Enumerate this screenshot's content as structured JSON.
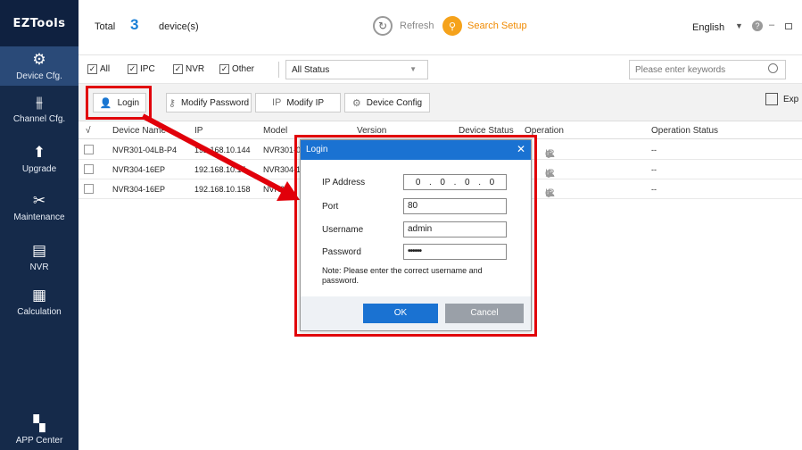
{
  "app": {
    "logo": "EZTools"
  },
  "sidebar": {
    "items": [
      {
        "label": "Device Cfg.",
        "icon": "gear-icon",
        "glyph": "⚙",
        "active": true
      },
      {
        "label": "Channel Cfg.",
        "icon": "sliders-icon",
        "glyph": "⫵"
      },
      {
        "label": "Upgrade",
        "icon": "upgrade-icon",
        "glyph": "⬆"
      },
      {
        "label": "Maintenance",
        "icon": "tools-icon",
        "glyph": "✂"
      },
      {
        "label": "NVR",
        "icon": "nvr-icon",
        "glyph": "▤"
      },
      {
        "label": "Calculation",
        "icon": "calculator-icon",
        "glyph": "▦"
      },
      {
        "label": "APP Center",
        "icon": "app-grid-icon",
        "glyph": "▚"
      }
    ]
  },
  "header": {
    "total_label": "Total",
    "total_count": "3",
    "devices_label": "device(s)",
    "refresh_label": "Refresh",
    "search_setup_label": "Search Setup",
    "language": "English"
  },
  "filters": {
    "all_label": "All",
    "ipc_label": "IPC",
    "nvr_label": "NVR",
    "other_label": "Other",
    "status_value": "All Status",
    "search_placeholder": "Please enter keywords"
  },
  "toolbar": {
    "login_label": "Login",
    "modify_password_label": "Modify Password",
    "modify_ip_label": "Modify IP",
    "device_config_label": "Device Config",
    "export_label": "Exp"
  },
  "table": {
    "columns": {
      "check": "√",
      "device_name": "Device Name",
      "ip": "IP",
      "model": "Model",
      "version": "Version",
      "device_status": "Device Status",
      "operation": "Operation",
      "operation_status": "Operation Status"
    },
    "rows": [
      {
        "name": "NVR301-04LB-P4",
        "ip": "192.168.10.144",
        "model": "NVR301-0",
        "op_status": "--"
      },
      {
        "name": "NVR304-16EP",
        "ip": "192.168.10.15",
        "model": "NVR304-1",
        "op_status": "--"
      },
      {
        "name": "NVR304-16EP",
        "ip": "192.168.10.158",
        "model": "NVR3",
        "op_status": "--"
      }
    ]
  },
  "dialog": {
    "title": "Login",
    "ip_label": "IP Address",
    "ip_octets": [
      "0",
      "0",
      "0",
      "0"
    ],
    "port_label": "Port",
    "port_value": "80",
    "username_label": "Username",
    "username_value": "admin",
    "password_label": "Password",
    "password_value": "••••••",
    "note": "Note: Please enter the correct username and password.",
    "ok_label": "OK",
    "cancel_label": "Cancel"
  },
  "colors": {
    "sidebar_bg": "#152a4a",
    "accent_blue": "#1a72d2",
    "annotation_red": "#e1000a",
    "search_setup_orange": "#f5a21b"
  }
}
